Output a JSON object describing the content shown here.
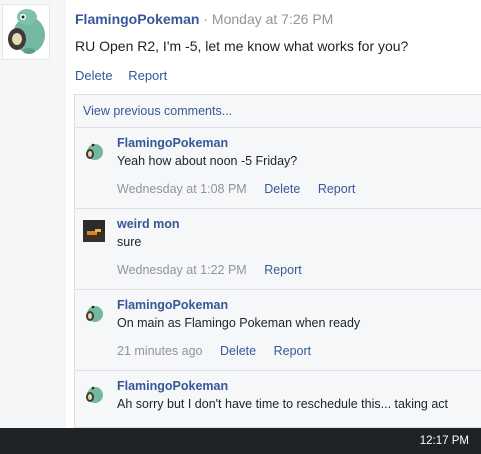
{
  "post": {
    "author": "FlamingoPokeman",
    "separator": " · ",
    "time": "Monday at 7:26 PM",
    "body": "RU Open R2, I'm -5, let me know what works for you?",
    "actions": [
      "Delete",
      "Report"
    ]
  },
  "comments_panel": {
    "view_previous": "View previous comments...",
    "items": [
      {
        "author": "FlamingoPokeman",
        "text": "Yeah how about noon -5 Friday?",
        "time": "Wednesday at 1:08 PM",
        "actions": [
          "Delete",
          "Report"
        ],
        "avatar": "flamingo-pokemon-icon"
      },
      {
        "author": "weird mon",
        "text": "sure",
        "time": "Wednesday at 1:22 PM",
        "actions": [
          "Report"
        ],
        "avatar": "game-thumbnail-icon"
      },
      {
        "author": "FlamingoPokeman",
        "text": "On main as Flamingo Pokeman when ready",
        "time": "21 minutes ago",
        "actions": [
          "Delete",
          "Report"
        ],
        "avatar": "flamingo-pokemon-icon"
      },
      {
        "author": "FlamingoPokeman",
        "text": "Ah sorry but I don't have time to reschedule this... taking act",
        "time": "",
        "actions": [],
        "avatar": "flamingo-pokemon-icon"
      }
    ]
  },
  "taskbar": {
    "clock": "12:17 PM"
  },
  "colors": {
    "link": "#365899",
    "meta": "#90949c",
    "panel": "#f6f7f9",
    "taskbar": "#1f2326"
  }
}
